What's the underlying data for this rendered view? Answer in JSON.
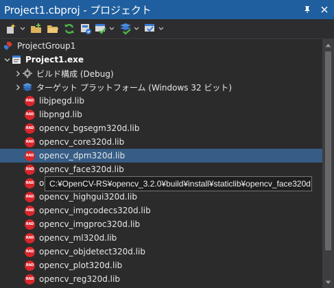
{
  "window": {
    "title": "Project1.cbproj - プロジェクト",
    "pin_glyph": "⬇",
    "close_glyph": "✕"
  },
  "colors": {
    "titlebar": "#1f5f9f",
    "selection": "#365d86",
    "rad_icon": "#d9262b"
  },
  "toolbar": {
    "buttons": [
      {
        "icon": "new-item-icon",
        "has_dropdown": true
      },
      {
        "icon": "add-folder-icon",
        "has_dropdown": false
      },
      {
        "icon": "open-folder-icon",
        "has_dropdown": false
      },
      {
        "icon": "sync-icon",
        "has_dropdown": false
      },
      {
        "icon": "build-config-icon",
        "has_dropdown": false
      },
      {
        "icon": "build-icon",
        "has_dropdown": true
      },
      {
        "icon": "build-all-icon",
        "has_dropdown": true
      },
      {
        "icon": "check-icon",
        "has_dropdown": true
      }
    ]
  },
  "tree": {
    "group": "ProjectGroup1",
    "project": "Project1.exe",
    "build_config": "ビルド構成 (Debug)",
    "target_platform": "ターゲット プラットフォーム (Windows 32 ビット)",
    "rad_badge": "RAD",
    "files": [
      "libjpegd.lib",
      "libpngd.lib",
      "opencv_bgsegm320d.lib",
      "opencv_core320d.lib",
      "opencv_dpm320d.lib",
      "opencv_face320d.lib",
      "op",
      "opencv_highgui320d.lib",
      "opencv_imgcodecs320d.lib",
      "opencv_imgproc320d.lib",
      "opencv_ml320d.lib",
      "opencv_objdetect320d.lib",
      "opencv_plot320d.lib",
      "opencv_reg320d.lib"
    ],
    "selected_file": "opencv_dpm320d.lib"
  },
  "tooltip": {
    "text": "C:¥OpenCV-RS¥opencv_3.2.0¥build¥install¥staticlib¥opencv_face320d.lib"
  }
}
